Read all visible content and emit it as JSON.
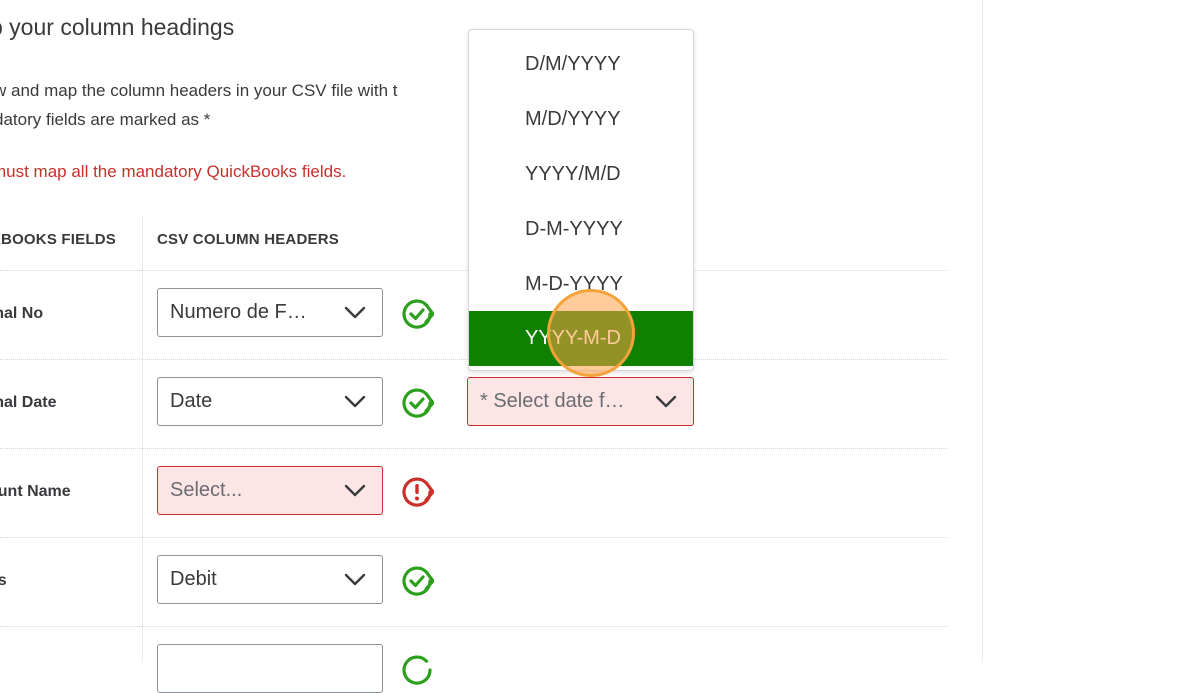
{
  "page": {
    "heading": "p your column headings",
    "desc_line1": "w and map the column headers in your CSV file with t",
    "desc_line2": "datory fields are marked as *",
    "error": "must map all the mandatory QuickBooks fields."
  },
  "table": {
    "headers": {
      "qb_fields": "KBOOKS FIELDS",
      "csv_headers": "CSV COLUMN HEADERS"
    },
    "rows": [
      {
        "label": "rnal No",
        "value": "Numero de F…",
        "status": "ok"
      },
      {
        "label": "rnal Date",
        "value": "Date",
        "status": "ok"
      },
      {
        "label": "ount Name",
        "value": "Select...",
        "status": "error"
      },
      {
        "label": "its",
        "value": "Debit",
        "status": "ok"
      }
    ]
  },
  "date_format": {
    "placeholder": "* Select date f…",
    "options": [
      "D/M/YYYY",
      "M/D/YYYY",
      "YYYY/M/D",
      "D-M-YYYY",
      "M-D-YYYY",
      "YYYY-M-D"
    ],
    "selected": "YYYY-M-D"
  },
  "colors": {
    "accent_green": "#108000",
    "status_green": "#2ca01c",
    "error_red": "#c9302c",
    "error_bg": "#fbe6e5",
    "cursor_orange": "#f3a33a"
  },
  "icons": {
    "ok": "check-circle-icon",
    "error": "exclamation-circle-icon",
    "chevron": "chevron-down-icon"
  }
}
